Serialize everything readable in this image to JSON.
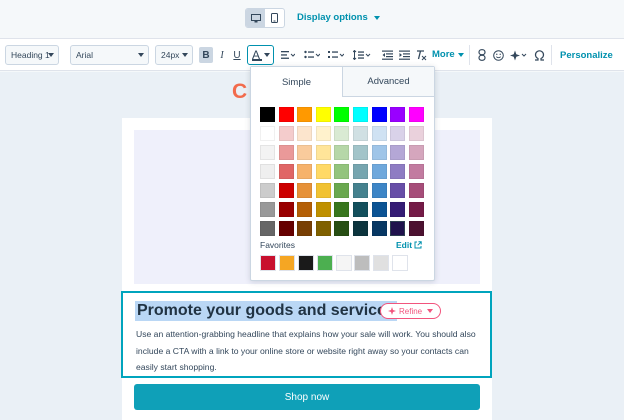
{
  "topbar": {
    "device_desktop_icon": "desktop-icon",
    "device_mobile_icon": "mobile-icon",
    "display_options_label": "Display options"
  },
  "toolbar": {
    "block_style": "Heading 1",
    "font_family": "Arial",
    "font_size": "24px",
    "bold": "B",
    "italic": "I",
    "underline": "U",
    "font_color_letter": "A",
    "more_label": "More",
    "personalize_label": "Personalize"
  },
  "canvas": {
    "partial_heading": "C",
    "module_heading": "Promote your goods and services",
    "refine_label": "Refine",
    "module_body": "Use an attention-grabbing headline that explains how your sale will work. You should also include a CTA with a link to your online store or website right away so your contacts can easily start shopping.",
    "shop_button_label": "Shop now"
  },
  "color_popover": {
    "tabs": [
      "Simple",
      "Advanced"
    ],
    "active_tab": "Simple",
    "favorites_label": "Favorites",
    "edit_label": "Edit",
    "swatch_rows": [
      [
        "#000000",
        "#ff0000",
        "#ff9900",
        "#ffff00",
        "#00ff00",
        "#00ffff",
        "#0000ff",
        "#9900ff",
        "#ff00ff"
      ],
      [
        "#ffffff",
        "#f4cccc",
        "#fce5cd",
        "#fff2cc",
        "#d9ead3",
        "#d0e0e3",
        "#cfe2f3",
        "#d9d2e9",
        "#ead1dc"
      ],
      [
        "#f3f3f3",
        "#ea9999",
        "#f9cb9c",
        "#ffe599",
        "#b6d7a8",
        "#a2c4c9",
        "#9fc5e8",
        "#b4a7d6",
        "#d5a6bd"
      ],
      [
        "#efefef",
        "#e06666",
        "#f6b26b",
        "#ffd966",
        "#93c47d",
        "#76a5af",
        "#6fa8dc",
        "#8e7cc3",
        "#c27ba0"
      ],
      [
        "#cccccc",
        "#cc0000",
        "#e69138",
        "#f1c232",
        "#6aa84f",
        "#45818e",
        "#3d85c6",
        "#674ea7",
        "#a64d79"
      ],
      [
        "#999999",
        "#990000",
        "#b45f06",
        "#bf9000",
        "#38761d",
        "#134f5c",
        "#0b5394",
        "#351c75",
        "#741b47"
      ],
      [
        "#666666",
        "#660000",
        "#783f04",
        "#7f6000",
        "#274e13",
        "#0c343d",
        "#073763",
        "#20124d",
        "#4c1130"
      ]
    ],
    "selected_swatch": "#20124d",
    "favorites": [
      "#c8102e",
      "#f5a623",
      "#1a1a1a",
      "#4caf50",
      "#f5f5f5",
      "#bdbdbd",
      "#e0e0e0",
      "#ffffff"
    ]
  }
}
